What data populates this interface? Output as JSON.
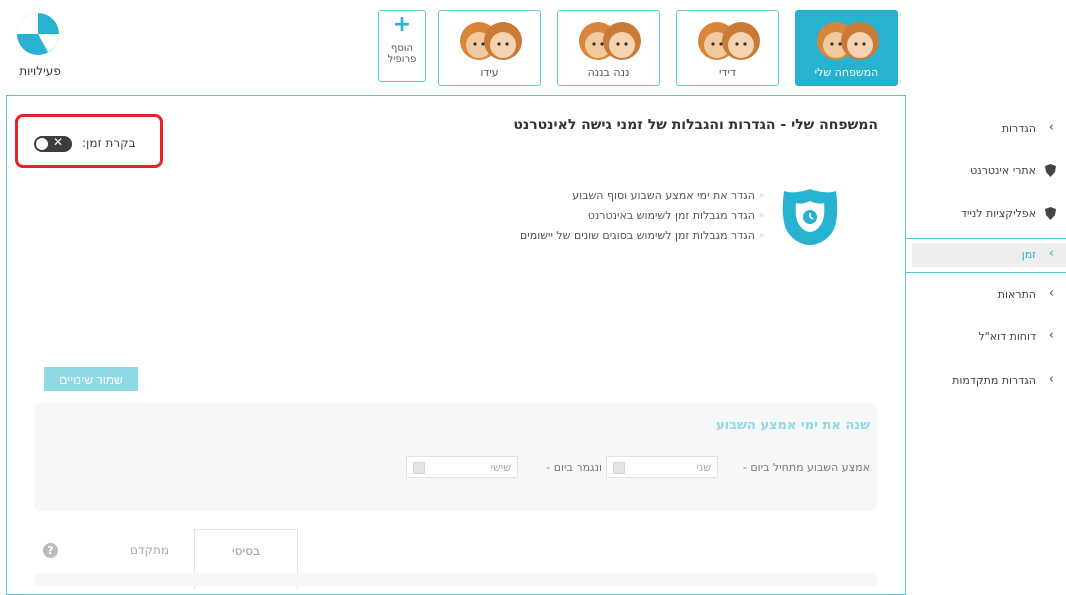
{
  "app": {
    "activities_label": "פעילויות"
  },
  "profiles": [
    {
      "name": "המשפחה שלי",
      "active": true
    },
    {
      "name": "דידי",
      "active": false
    },
    {
      "name": "ננה בננה",
      "active": false
    },
    {
      "name": "עידו",
      "active": false
    }
  ],
  "add_profile": {
    "icon": "plus-icon",
    "label_line1": "הוסף",
    "label_line2": "פרופיל"
  },
  "main": {
    "title": "המשפחה שלי - הגדרות והגבלות של זמני גישה לאינטרנט",
    "timer": {
      "label": "בקרת זמן:",
      "state": "off",
      "state_glyph": "✕"
    },
    "bullets": [
      "הגדר את ימי אמצע השבוע וסוף השבוע",
      "הגדר מגבלות זמן לשימוש באינטרנט",
      "הגדר מגבלות זמן לשימוש בסוגים שונים של יישומים"
    ],
    "save_button": "שמור שינויים",
    "week_section": {
      "title": "שנה את ימי אמצע השבוע",
      "start_label": "אמצע השבוע מתחיל ביום -",
      "start_value": "שני",
      "end_label": "ונגמר ביום -",
      "end_value": "שישי"
    },
    "tabs": {
      "basic": "בסיסי",
      "advanced": "מתקדם"
    },
    "help_glyph": "?"
  },
  "sidebar": {
    "items": [
      {
        "label": "הגדרות",
        "icon": "chevron-left-icon",
        "glyph": "‹"
      },
      {
        "label": "אתרי אינטרנט",
        "icon": "shield-icon",
        "glyph": ""
      },
      {
        "label": "אפליקציות לנייד",
        "icon": "shield-icon",
        "glyph": ""
      },
      {
        "label": "זמן",
        "icon": "chevron-left-icon",
        "glyph": "‹",
        "active": true
      },
      {
        "label": "התראות",
        "icon": "chevron-left-icon",
        "glyph": "‹"
      },
      {
        "label": "דוחות דוא\"ל",
        "icon": "chevron-left-icon",
        "glyph": "‹"
      },
      {
        "label": "הגדרות מתקדמות",
        "icon": "chevron-left-icon",
        "glyph": "‹"
      }
    ]
  },
  "colors": {
    "accent": "#27b3cf",
    "highlight_border": "#e0262b",
    "panel_border": "#5bc6d6"
  }
}
